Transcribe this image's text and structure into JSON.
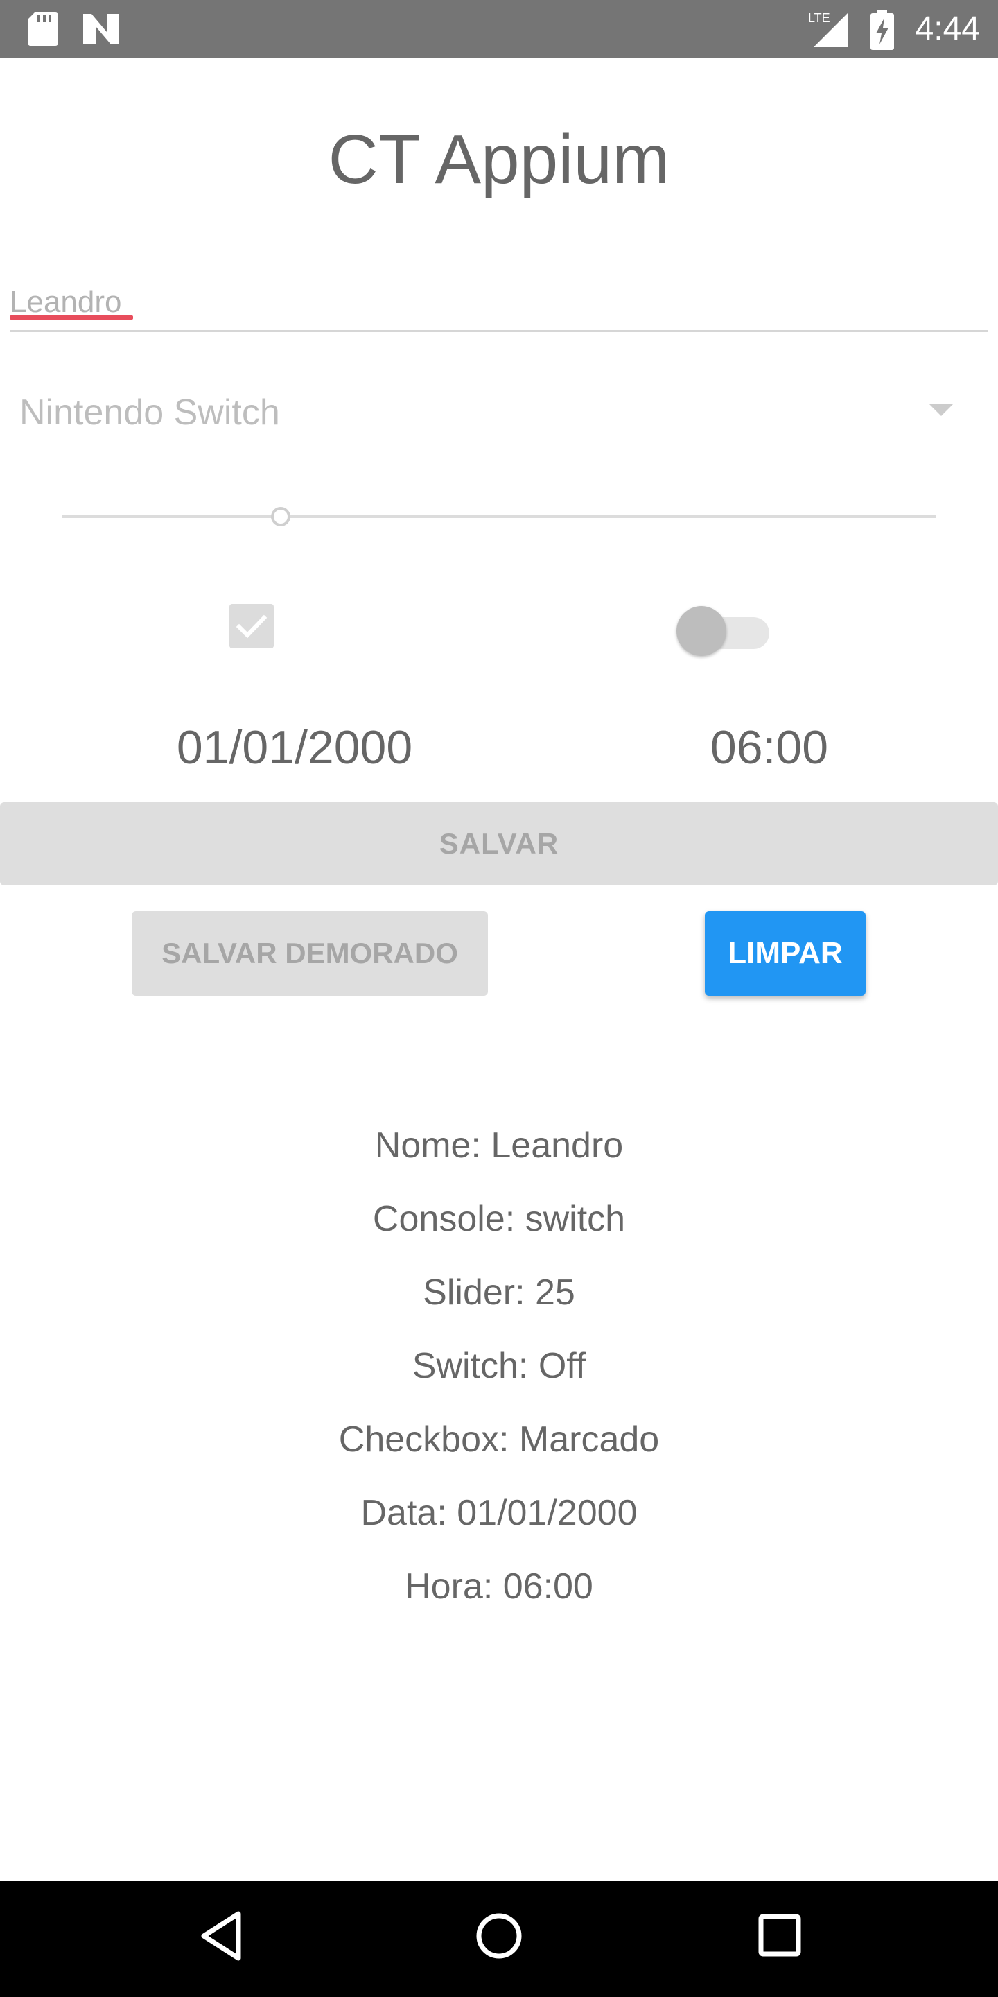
{
  "status_bar": {
    "time": "4:44",
    "network_label": "LTE",
    "icons": [
      "sd-card-icon",
      "n-logo-icon",
      "lte-signal-icon",
      "battery-charging-icon"
    ]
  },
  "app": {
    "title": "CT Appium"
  },
  "form": {
    "name_value": "Leandro",
    "console_selected": "Nintendo Switch",
    "slider_value": 25,
    "slider_fraction": 0.25,
    "checkbox_checked": true,
    "switch_on": false,
    "date": "01/01/2000",
    "time": "06:00"
  },
  "buttons": {
    "save": "SALVAR",
    "save_delayed": "SALVAR DEMORADO",
    "clear": "LIMPAR"
  },
  "results": [
    "Nome: Leandro",
    "Console: switch",
    "Slider: 25",
    "Switch: Off",
    "Checkbox: Marcado",
    "Data: 01/01/2000",
    "Hora: 06:00"
  ],
  "colors": {
    "status_bar": "#757575",
    "accent_blue": "#2196f3",
    "spell_underline": "#e84d5c",
    "disabled_button": "#dedede",
    "text_gray": "#666666"
  },
  "nav_bar": {
    "icons": [
      "back-icon",
      "home-icon",
      "recents-icon"
    ]
  }
}
